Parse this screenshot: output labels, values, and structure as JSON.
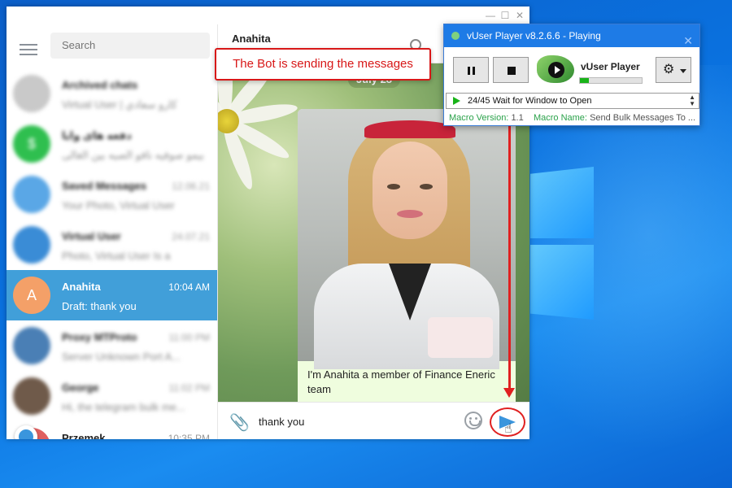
{
  "telegram": {
    "search_placeholder": "Search",
    "chats": [
      {
        "name": "Archived chats",
        "time": "",
        "preview": "Virtual User | كارو سعادي",
        "avatar_color": "#c9c9c9",
        "initial": "",
        "blurred": true
      },
      {
        "name": "دفعه های وایا",
        "time": "",
        "preview": "بیمو صوفیه نافو الصیه بین الغالی",
        "avatar_color": "#2fbf4f",
        "initial": "$",
        "blurred": true
      },
      {
        "name": "Saved Messages",
        "time": "12.06.21",
        "preview": "Your Photo, Virtual User",
        "avatar_color": "#5aa7e6",
        "initial": "",
        "blurred": true
      },
      {
        "name": "Virtual User",
        "time": "24.07.21",
        "preview": "Photo, Virtual User Is a",
        "avatar_color": "#3a8cd6",
        "initial": "",
        "blurred": true
      },
      {
        "name": "Anahita",
        "time": "10:04 AM",
        "preview": "Draft: thank you",
        "avatar_color": "#f4a068",
        "initial": "A",
        "blurred": false,
        "active": true
      },
      {
        "name": "Proxy MTProto",
        "time": "11:00 PM",
        "preview": "Server Unknown Port A...",
        "avatar_color": "#4a7fb5",
        "initial": "",
        "blurred": true
      },
      {
        "name": "George",
        "time": "11:02 PM",
        "preview": "Hi, the telegram bulk me...",
        "avatar_color": "#6f5a4a",
        "initial": "",
        "blurred": true
      },
      {
        "name": "Przemek",
        "time": "10:35 PM",
        "preview": "",
        "avatar_color": "#e06060",
        "initial": "",
        "blurred": false
      }
    ],
    "chat_title": "Anahita",
    "date_label": "July 28",
    "message_text": "I'm Anahita a member of Finance Eneric team",
    "composer_value": "thank you"
  },
  "annotation": {
    "callout_text": "The Bot is sending the messages",
    "color": "#d81818"
  },
  "vuser": {
    "window_title": "vUser Player v8.2.6.6 - Playing",
    "app_name": "vUser Player",
    "progress_fraction": 0.15,
    "status_text": "24/45 Wait for Window to Open",
    "macro_version_label": "Macro Version:",
    "macro_version_value": "1.1",
    "macro_name_label": "Macro Name:",
    "macro_name_value": "Send Bulk Messages To ...",
    "accent_color": "#1e7be6"
  }
}
